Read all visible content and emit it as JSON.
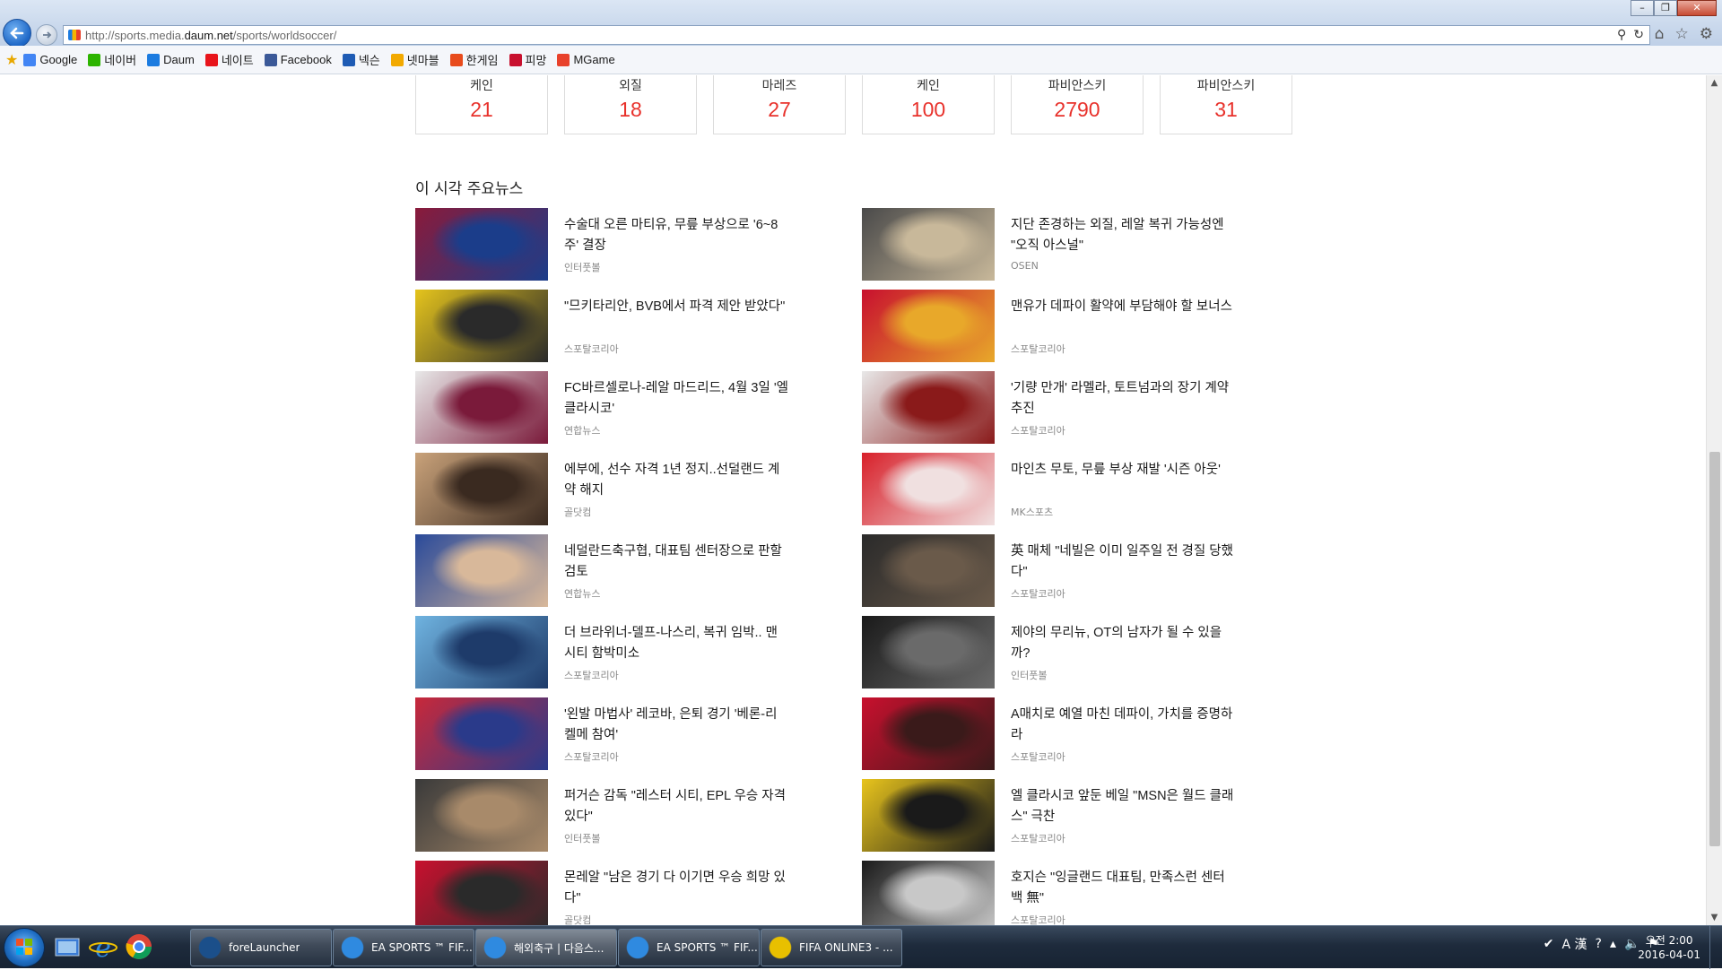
{
  "browser": {
    "url_prefix": "http://sports.media.",
    "url_domain": "daum.net",
    "url_path": "/sports/worldsoccer/",
    "favorites": [
      "Google",
      "네이버",
      "Daum",
      "네이트",
      "Facebook",
      "넥슨",
      "넷마블",
      "한게임",
      "피망",
      "MGame"
    ],
    "favorite_colors": [
      "#4285f4",
      "#2db400",
      "#1b7be0",
      "#e8141b",
      "#3b5998",
      "#1e5bb4",
      "#f2a900",
      "#e84b1c",
      "#c8102e",
      "#e8412b"
    ]
  },
  "stats": [
    {
      "name": "케인",
      "value": "21"
    },
    {
      "name": "외질",
      "value": "18"
    },
    {
      "name": "마레즈",
      "value": "27"
    },
    {
      "name": "케인",
      "value": "100"
    },
    {
      "name": "파비안스키",
      "value": "2790"
    },
    {
      "name": "파비안스키",
      "value": "31"
    }
  ],
  "news_heading": "이 시각 주요뉴스",
  "news_left": [
    {
      "title": "수술대 오른 마티유, 무릎 부상으로 '6~8주' 결장",
      "source": "인터풋볼",
      "thumb": [
        "#8a1a3a",
        "#1b3d8a"
      ]
    },
    {
      "title": "\"므키타리안, BVB에서 파격 제안 받았다\"",
      "source": "스포탈코리아",
      "thumb": [
        "#e5c41c",
        "#2a2a2a"
      ]
    },
    {
      "title": "FC바르셀로나-레알 마드리드, 4월 3일 '엘 클라시코'",
      "source": "연합뉴스",
      "thumb": [
        "#e8e8e8",
        "#7a1a3a"
      ]
    },
    {
      "title": "에부에, 선수 자격 1년 정지..선덜랜드 계약 해지",
      "source": "골닷컴",
      "thumb": [
        "#c9a27a",
        "#3a2a20"
      ]
    },
    {
      "title": "네덜란드축구협, 대표팀 센터장으로 판할 검토",
      "source": "연합뉴스",
      "thumb": [
        "#2a4a9a",
        "#d8b89a"
      ]
    },
    {
      "title": "더 브라위너-델프-나스리, 복귀 임박.. 맨시티 함박미소",
      "source": "스포탈코리아",
      "thumb": [
        "#6fb3e0",
        "#1e3b6a"
      ]
    },
    {
      "title": "'왼발 마법사' 레코바, 은퇴 경기 '베론-리켈메 참여'",
      "source": "스포탈코리아",
      "thumb": [
        "#c8283a",
        "#2a3a8a"
      ]
    },
    {
      "title": "퍼거슨 감독 \"레스터 시티, EPL 우승 자격있다\"",
      "source": "인터풋볼",
      "thumb": [
        "#3a3a3a",
        "#a88a6a"
      ]
    },
    {
      "title": "몬레알 \"남은 경기 다 이기면 우승 희망 있다\"",
      "source": "골닷컴",
      "thumb": [
        "#c8102e",
        "#2a2a2a"
      ]
    }
  ],
  "news_right": [
    {
      "title": "지단 존경하는 외질, 레알 복귀 가능성엔 \"오직 아스널\"",
      "source": "OSEN",
      "thumb": [
        "#4a4a4a",
        "#c8b89a"
      ]
    },
    {
      "title": "맨유가 데파이 활약에 부담해야 할 보너스",
      "source": "스포탈코리아",
      "thumb": [
        "#c8102e",
        "#e8a82a"
      ]
    },
    {
      "title": "'기량 만개' 라멜라, 토트넘과의 장기 계약 추진",
      "source": "스포탈코리아",
      "thumb": [
        "#e8e8e8",
        "#8a1a1a"
      ]
    },
    {
      "title": "마인츠 무토, 무릎 부상 재발 '시즌 아웃'",
      "source": "MK스포츠",
      "thumb": [
        "#d8202a",
        "#f0e0e0"
      ]
    },
    {
      "title": "英 매체 \"네빌은 이미 일주일 전 경질 당했다\"",
      "source": "스포탈코리아",
      "thumb": [
        "#2a2a2a",
        "#6a5a4a"
      ]
    },
    {
      "title": "제야의 무리뉴, OT의 남자가 될 수 있을까?",
      "source": "인터풋볼",
      "thumb": [
        "#1a1a1a",
        "#6a6a6a"
      ]
    },
    {
      "title": "A매치로 예열 마친 데파이, 가치를 증명하라",
      "source": "스포탈코리아",
      "thumb": [
        "#c8102e",
        "#3a1a1a"
      ]
    },
    {
      "title": "엘 클라시코 앞둔 베일 \"MSN은 월드 클래스\" 극찬",
      "source": "스포탈코리아",
      "thumb": [
        "#e8c41c",
        "#1a1a1a"
      ]
    },
    {
      "title": "호지슨 \"잉글랜드 대표팀, 만족스런 센터백 無\"",
      "source": "스포탈코리아",
      "thumb": [
        "#1a1a1a",
        "#c8c8c8"
      ]
    }
  ],
  "taskbar": {
    "buttons": [
      "foreLauncher",
      "EA SPORTS ™ FIF...",
      "해외축구 | 다음스...",
      "EA SPORTS ™ FIF...",
      "FIFA ONLINE3 - ..."
    ],
    "tray_ime": "A 漢",
    "clock_time": "오전 2:00",
    "clock_date": "2016-04-01"
  }
}
